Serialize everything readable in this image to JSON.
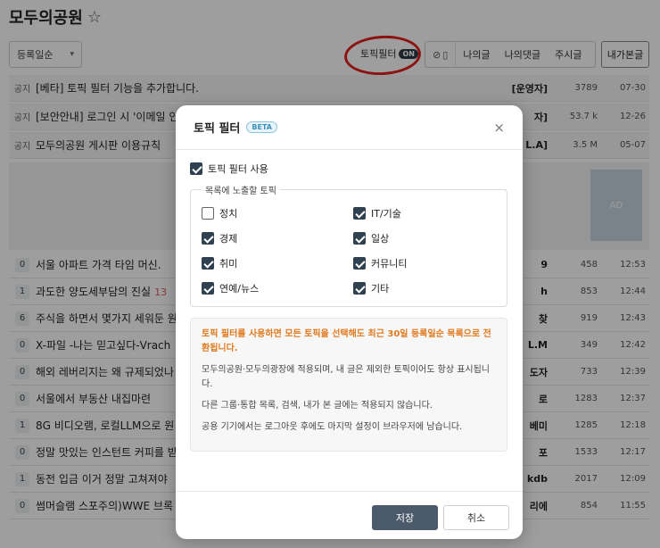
{
  "board": {
    "title": "모두의공원",
    "star": "☆",
    "sort_label": "등록일순",
    "topic_filter_label": "토픽필터",
    "topic_filter_state": "ON",
    "group_buttons": [
      "나의글",
      "나의댓글",
      "주시글"
    ],
    "mypage_label": "내가본글",
    "notice_label": "공지",
    "ad_label": "AD",
    "notices": [
      {
        "subject": "[베타] 토픽 필터 기능을 추가합니다.",
        "author": "[운영자]",
        "hits": "3789",
        "time": "07-30"
      },
      {
        "subject": "[보안안내] 로그인 시 '이메일 인",
        "author": "자]",
        "hits": "53.7 k",
        "time": "12-26"
      },
      {
        "subject": "모두의공원 게시판 이용규칙",
        "author": "L.A]",
        "hits": "3.5 M",
        "time": "05-07"
      }
    ],
    "posts": [
      {
        "comments": "0",
        "subject": "서울 아파트 가격 타임 머신.",
        "extra": "",
        "author": "9",
        "hits": "458",
        "time": "12:53"
      },
      {
        "comments": "1",
        "subject": "과도한 양도세부담의 진실",
        "extra": "13",
        "author": "h",
        "hits": "853",
        "time": "12:44"
      },
      {
        "comments": "6",
        "subject": "주식을 하면서 몇가지 세워둔 원",
        "extra": "",
        "author": "찾",
        "hits": "919",
        "time": "12:43"
      },
      {
        "comments": "0",
        "subject": "X-파일 -나는 믿고싶다-Vrach",
        "extra": "",
        "author": "L.M",
        "hits": "349",
        "time": "12:42"
      },
      {
        "comments": "0",
        "subject": "해외 레버리지는 왜 규제되었나",
        "extra": "",
        "author": "도자",
        "hits": "733",
        "time": "12:39"
      },
      {
        "comments": "0",
        "subject": "서울에서 부동산 내집마련",
        "extra": "",
        "author": "로",
        "hits": "1283",
        "time": "12:37"
      },
      {
        "comments": "1",
        "subject": "8G 비디오램, 로컬LLM으로 원",
        "extra": "",
        "author": "베미",
        "hits": "1285",
        "time": "12:18"
      },
      {
        "comments": "0",
        "subject": "정말 맛있는 인스턴트 커피를 받",
        "extra": "",
        "author": "포",
        "hits": "1533",
        "time": "12:17"
      },
      {
        "comments": "1",
        "subject": "동전 입금 이거 정말 고쳐져야",
        "extra": "",
        "author": "kdb",
        "hits": "2017",
        "time": "12:09"
      },
      {
        "comments": "0",
        "subject": "썸머슬램 스포주의)WWE 브록",
        "extra": "",
        "author": "리에",
        "hits": "854",
        "time": "11:55"
      }
    ]
  },
  "modal": {
    "title": "토픽 필터",
    "beta": "BETA",
    "close": "×",
    "use_label": "토픽 필터 사용",
    "use_checked": true,
    "fieldset_legend": "목록에 노출할 토픽",
    "topics_left": [
      {
        "label": "정치",
        "checked": false
      },
      {
        "label": "경제",
        "checked": true
      },
      {
        "label": "취미",
        "checked": true
      },
      {
        "label": "연예/뉴스",
        "checked": true
      }
    ],
    "topics_right": [
      {
        "label": "IT/기술",
        "checked": true
      },
      {
        "label": "일상",
        "checked": true
      },
      {
        "label": "커뮤니티",
        "checked": true
      },
      {
        "label": "기타",
        "checked": true
      }
    ],
    "warning": "토픽 필터를 사용하면 모든 토픽을 선택해도 최근 30일 등록일순 목록으로 전환됩니다.",
    "info_1": "모두의공원·모두의광장에 적용되며, 내 글은 제외한 토픽이어도 항상 표시됩니다.",
    "info_2": "다른 그룹·통합 목록, 검색, 내가 본 글에는 적용되지 않습니다.",
    "info_3": "공용 기기에서는 로그아웃 후에도 마지막 설정이 브라우저에 남습니다.",
    "save_label": "저장",
    "cancel_label": "취소"
  },
  "colors": {
    "accent": "#2f4050",
    "warning": "#e07a1f",
    "annotation": "#e0201e"
  }
}
